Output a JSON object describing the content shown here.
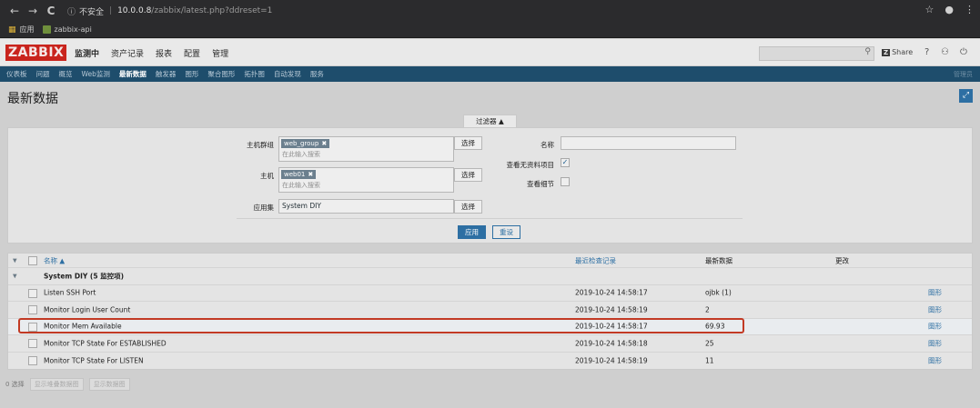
{
  "browser": {
    "back": "←",
    "forward": "→",
    "reload": "C",
    "insecure_label": "不安全",
    "host": "10.0.0.8",
    "path": "/zabbix/latest.php?ddreset=1",
    "bookmarks": [
      {
        "label": "应用"
      },
      {
        "label": "zabbix-api"
      }
    ]
  },
  "header": {
    "logo": "ZABBIX",
    "menu": [
      "监测中",
      "资产记录",
      "报表",
      "配置",
      "管理"
    ],
    "share_label": "Share",
    "help": "?",
    "user": "👤",
    "logout": "⏻"
  },
  "subnav": {
    "items": [
      "仪表板",
      "问题",
      "概览",
      "Web监测",
      "最新数据",
      "触发器",
      "图形",
      "聚合图形",
      "拓扑图",
      "自动发现",
      "服务"
    ],
    "active_index": 4,
    "right": "管理员"
  },
  "page": {
    "title": "最新数据"
  },
  "filter": {
    "tab_label": "过滤器 ▲",
    "host_group_label": "主机群组",
    "host_group_tag": "web_group",
    "host_label": "主机",
    "host_tag": "web01",
    "placeholder": "在此输入搜索",
    "app_label": "应用集",
    "app_value": "System DIY",
    "select_label": "选择",
    "name_label": "名称",
    "name_value": "",
    "show_no_data_label": "查看无资料项目",
    "show_no_data_checked": true,
    "show_details_label": "查看细节",
    "show_details_checked": false,
    "apply_label": "应用",
    "reset_label": "重设"
  },
  "table": {
    "columns": {
      "name": "名称 ▲",
      "last_check": "最近检查记录",
      "last_value": "最新数据",
      "change": "更改"
    },
    "group_row": "System DIY (5 监控项)",
    "rows": [
      {
        "name": "Listen SSH Port",
        "last_check": "2019-10-24 14:58:17",
        "last_value": "ojbk (1)",
        "link": "图形"
      },
      {
        "name": "Monitor Login User Count",
        "last_check": "2019-10-24 14:58:19",
        "last_value": "2",
        "link": "图形"
      },
      {
        "name": "Monitor Mem Available",
        "last_check": "2019-10-24 14:58:17",
        "last_value": "69.93",
        "link": "图形"
      },
      {
        "name": "Monitor TCP State For ESTABLISHED",
        "last_check": "2019-10-24 14:58:18",
        "last_value": "25",
        "link": "图形"
      },
      {
        "name": "Monitor TCP State For LISTEN",
        "last_check": "2019-10-24 14:58:19",
        "last_value": "11",
        "link": "图形"
      }
    ]
  },
  "footer": {
    "selected": "0 选择",
    "btn_stacked": "显示堆叠数据图",
    "btn_graph": "显示数据图"
  }
}
